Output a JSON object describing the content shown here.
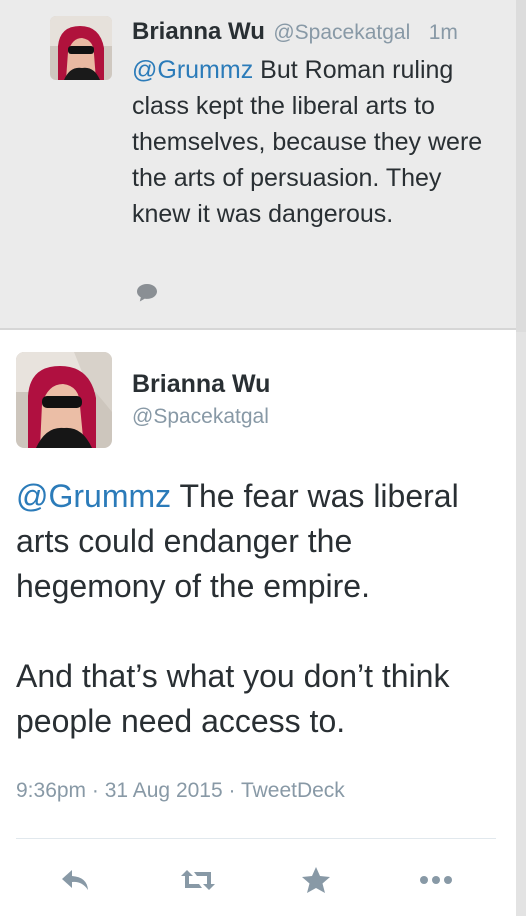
{
  "reply_tweet": {
    "author_name": "Brianna Wu",
    "author_handle": "@Spacekatgal",
    "time_ago": "1m",
    "mention": "@Grummz",
    "text": " But Roman ruling class kept the liberal arts to themselves, because they were the arts of persuasion. They knew it was dangerous.",
    "icons": {
      "avatar": "avatar-photo",
      "reply": "comment-icon"
    }
  },
  "main_tweet": {
    "author_name": "Brianna Wu",
    "author_handle": "@Spacekatgal",
    "mention": "@Grummz",
    "text_first": " The fear was liberal arts could endanger the hegemony of the empire.",
    "text_second": "And that’s what you don’t think people need access to.",
    "meta": "9:36pm · 31 Aug 2015 · TweetDeck",
    "actions": [
      {
        "name": "reply",
        "icon": "reply-icon"
      },
      {
        "name": "retweet",
        "icon": "retweet-icon"
      },
      {
        "name": "favorite",
        "icon": "star-icon"
      },
      {
        "name": "more",
        "icon": "more-icon"
      }
    ]
  },
  "colors": {
    "text": "#292f33",
    "secondary": "#8899a6",
    "link": "#2b7bb9",
    "reply_bg": "#ebebeb",
    "action_icon": "#8899a6"
  }
}
